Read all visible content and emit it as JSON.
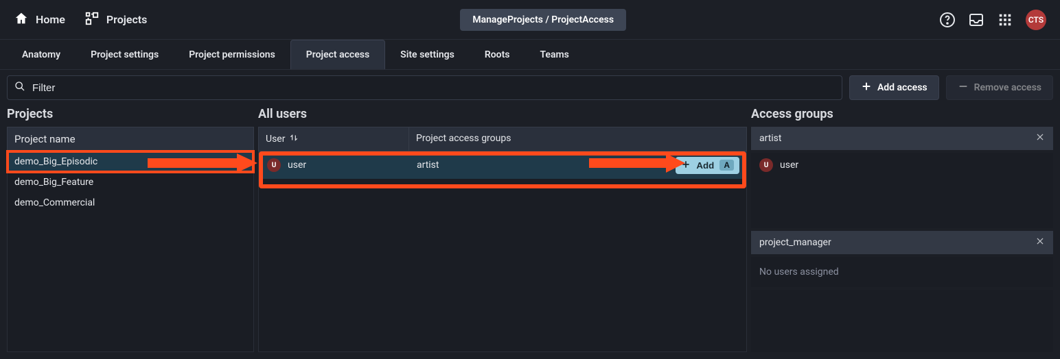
{
  "topnav": {
    "home": "Home",
    "projects": "Projects",
    "breadcrumb": "ManageProjects / ProjectAccess",
    "avatar_initials": "CTS"
  },
  "tabs": [
    {
      "label": "Anatomy",
      "active": false
    },
    {
      "label": "Project settings",
      "active": false
    },
    {
      "label": "Project permissions",
      "active": false
    },
    {
      "label": "Project access",
      "active": true
    },
    {
      "label": "Site settings",
      "active": false
    },
    {
      "label": "Roots",
      "active": false
    },
    {
      "label": "Teams",
      "active": false
    }
  ],
  "filter": {
    "placeholder": "Filter"
  },
  "buttons": {
    "add_access": "Add access",
    "remove_access": "Remove access",
    "add": "Add",
    "add_kbd": "A"
  },
  "columns": {
    "projects_title": "Projects",
    "allusers_title": "All users",
    "access_title": "Access groups",
    "project_name_header": "Project name",
    "user_header": "User",
    "groups_header": "Project access groups"
  },
  "projects": [
    {
      "name": "demo_Big_Episodic",
      "selected": true,
      "highlight": true
    },
    {
      "name": "demo_Big_Feature",
      "selected": false,
      "highlight": false
    },
    {
      "name": "demo_Commercial",
      "selected": false,
      "highlight": false
    }
  ],
  "users": [
    {
      "initial": "U",
      "name": "user",
      "groups": "artist"
    }
  ],
  "access_groups": [
    {
      "name": "artist",
      "users": [
        {
          "initial": "U",
          "name": "user"
        }
      ],
      "empty_text": null
    },
    {
      "name": "project_manager",
      "users": [],
      "empty_text": "No users assigned"
    }
  ]
}
